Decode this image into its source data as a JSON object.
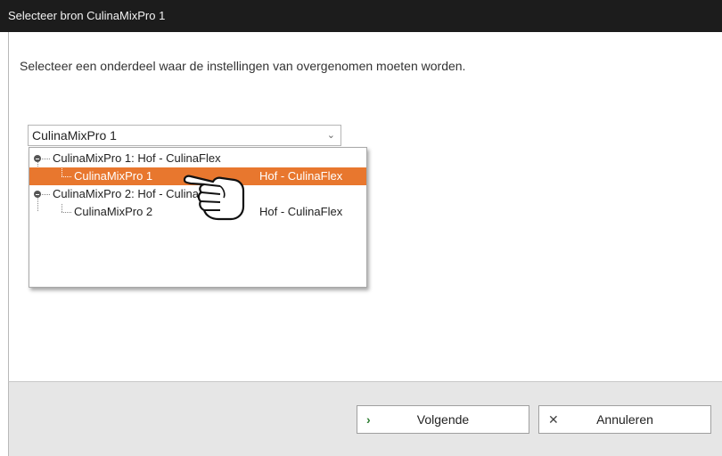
{
  "window": {
    "title": "Selecteer bron CulinaMixPro 1"
  },
  "main": {
    "instruction": "Selecteer een onderdeel waar de instellingen van overgenomen moeten worden.",
    "combo": {
      "value": "CulinaMixPro 1"
    }
  },
  "tree": {
    "groups": [
      {
        "label": "CulinaMixPro 1: Hof - CulinaFlex",
        "children": [
          {
            "label": "CulinaMixPro 1",
            "group": "Hof - CulinaFlex",
            "selected": true
          }
        ]
      },
      {
        "label": "CulinaMixPro 2: Hof - CulinaFlex",
        "children": [
          {
            "label": "CulinaMixPro 2",
            "group": "Hof - CulinaFlex",
            "selected": false
          }
        ]
      }
    ]
  },
  "footer": {
    "next_label": "Volgende",
    "cancel_label": "Annuleren"
  },
  "colors": {
    "titlebar": "#1c1c1c",
    "selection": "#e8772e",
    "next_icon": "#2e7d32"
  },
  "icons": {
    "combo": "chevron-down-icon",
    "expanded": "minus-circle-icon",
    "cursor": "hand-pointer-icon",
    "next": "chevron-right-icon",
    "cancel": "close-icon"
  }
}
